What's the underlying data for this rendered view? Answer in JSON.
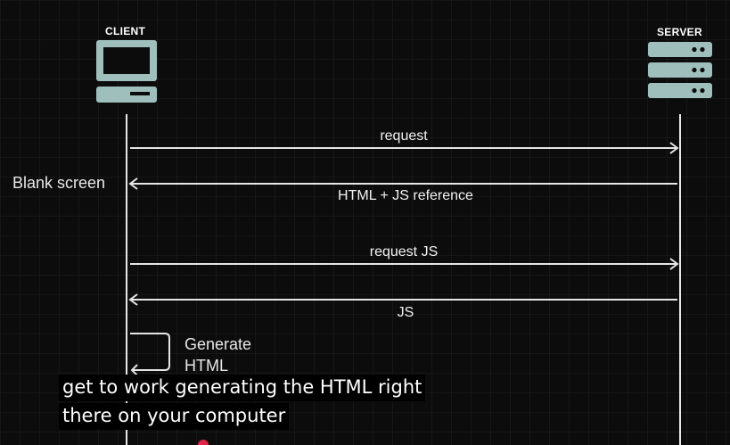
{
  "client": {
    "title": "CLIENT",
    "side_note": "Blank screen",
    "process_label": "Generate HTML"
  },
  "server": {
    "title": "SERVER"
  },
  "messages": [
    {
      "label": "request",
      "direction": "client-to-server"
    },
    {
      "label": "HTML + JS reference",
      "direction": "server-to-client"
    },
    {
      "label": "request JS",
      "direction": "client-to-server"
    },
    {
      "label": "JS",
      "direction": "server-to-client"
    }
  ],
  "caption": {
    "line1": "get to work generating the HTML right",
    "line2": "there on your computer"
  },
  "colors": {
    "icon_fill": "#9fbfbc",
    "line": "#e6e6e6",
    "background": "#0c0c0c",
    "caption_bg": "#000000",
    "progress_dot": "#e0244a"
  },
  "icons": {
    "client": "computer-monitor-icon",
    "server": "server-rack-icon"
  }
}
